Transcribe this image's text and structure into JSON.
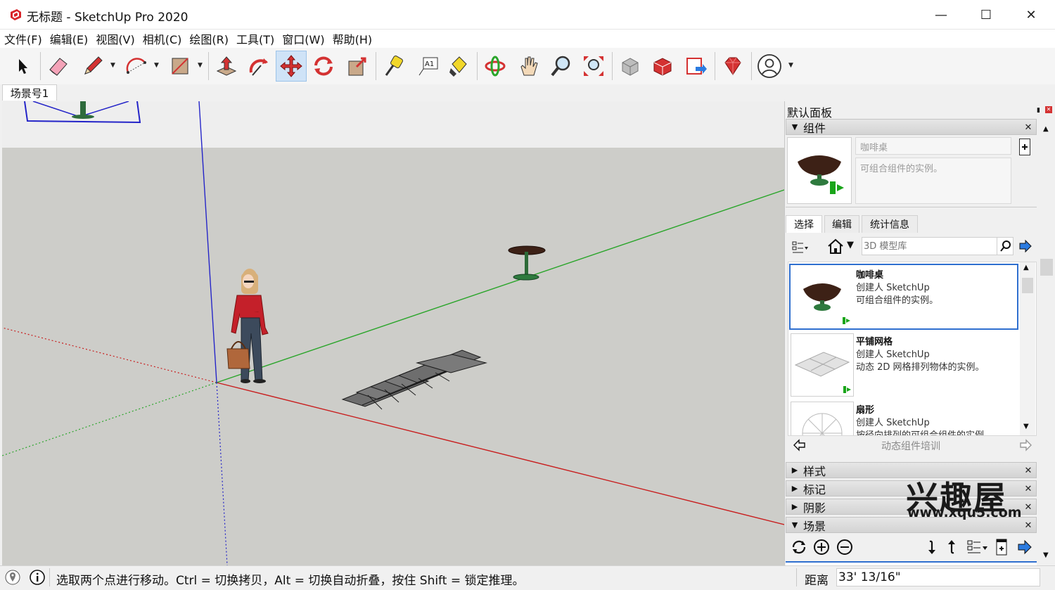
{
  "window": {
    "title": "无标题 - SketchUp Pro 2020",
    "minimize": "—",
    "maximize": "☐",
    "close": "✕"
  },
  "menu": [
    "文件(F)",
    "编辑(E)",
    "视图(V)",
    "相机(C)",
    "绘图(R)",
    "工具(T)",
    "窗口(W)",
    "帮助(H)"
  ],
  "scene_tab": "场景号1",
  "panel": {
    "title": "默认面板",
    "components": {
      "header": "组件",
      "name": "咖啡桌",
      "description": "可组合组件的实例。",
      "tabs": [
        "选择",
        "编辑",
        "统计信息"
      ],
      "search_placeholder": "3D 模型库",
      "items": [
        {
          "title": "咖啡桌",
          "author": "创建人 SketchUp",
          "desc": "可组合组件的实例。"
        },
        {
          "title": "平铺网格",
          "author": "创建人 SketchUp",
          "desc": "动态 2D 网格排列物体的实例。"
        },
        {
          "title": "扇形",
          "author": "创建人 SketchUp",
          "desc": "按径向排列的可组合组件的实例。"
        }
      ],
      "nav_label": "动态组件培训"
    },
    "collapsed": [
      "样式",
      "标记",
      "阴影"
    ],
    "scenes_header": "场景",
    "close_glyph": "✕",
    "expanded_glyph": "▼",
    "collapsed_glyph": "▶"
  },
  "status": {
    "hint": "选取两个点进行移动。Ctrl = 切换拷贝，Alt = 切换自动折叠，按住 Shift = 锁定推理。",
    "measure_label": "距离",
    "measure_value": "33' 13/16\""
  },
  "watermark": {
    "main": "兴趣屋",
    "url": "www.xqu5.com"
  },
  "colors": {
    "selection": "#2f6fcf",
    "axis_red": "#c81e1e",
    "axis_green": "#2aa52a",
    "axis_blue": "#2323c8",
    "ground": "#cdcdc9",
    "sky": "#eeeeee"
  }
}
